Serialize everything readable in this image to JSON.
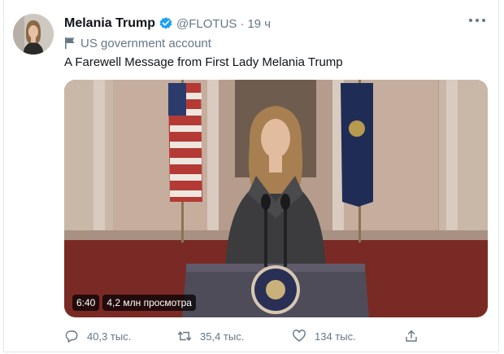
{
  "tweet": {
    "author_name": "Melania Trump",
    "handle": "@FLOTUS",
    "separator": "·",
    "time": "19 ч",
    "govt_label": "US government account",
    "text": "A Farewell Message from First Lady Melania Trump"
  },
  "video": {
    "duration": "6:40",
    "views": "4,2 млн просмотра"
  },
  "actions": {
    "replies": "40,3 тыс.",
    "retweets": "35,4 тыс.",
    "likes": "134 тыс."
  },
  "icons": {
    "verified": "verified-badge-icon",
    "govt": "flag-icon",
    "more": "more-dots-icon",
    "reply": "reply-icon",
    "retweet": "retweet-icon",
    "like": "heart-icon",
    "share": "share-icon"
  },
  "colors": {
    "text": "#0f1419",
    "secondary": "#657786",
    "verified": "#1da1f2",
    "border": "#e1e8ed"
  }
}
